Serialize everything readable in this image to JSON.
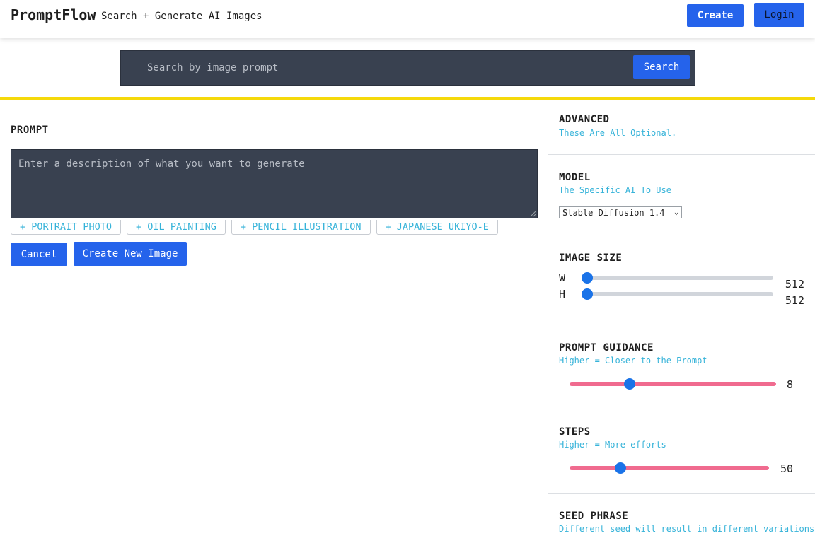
{
  "header": {
    "logo": "PromptFlow",
    "tagline": "Search + Generate AI Images",
    "create_label": "Create",
    "login_label": "Login"
  },
  "search": {
    "placeholder": "Search by image prompt",
    "button_label": "Search"
  },
  "prompt": {
    "title": "PROMPT",
    "placeholder": "Enter a description of what you want to generate",
    "chips": [
      "+ PORTRAIT PHOTO",
      "+ OIL PAINTING",
      "+ PENCIL ILLUSTRATION",
      "+ JAPANESE UKIYO-E"
    ],
    "cancel_label": "Cancel",
    "create_label": "Create New Image"
  },
  "advanced": {
    "title": "ADVANCED",
    "subtitle": "These Are All Optional.",
    "model": {
      "title": "MODEL",
      "subtitle": "The Specific AI To Use",
      "selected": "Stable Diffusion 1.4"
    },
    "image_size": {
      "title": "IMAGE SIZE",
      "width_label": "W",
      "width_value": "512",
      "width_fraction": 0.0,
      "height_label": "H",
      "height_value": "512",
      "height_fraction": 0.0
    },
    "guidance": {
      "title": "PROMPT GUIDANCE",
      "subtitle": "Higher = Closer to the Prompt",
      "value": "8",
      "fraction": 0.28
    },
    "steps": {
      "title": "STEPS",
      "subtitle": "Higher = More efforts",
      "value": "50",
      "fraction": 0.24
    },
    "seed": {
      "title": "SEED PHRASE",
      "subtitle": "Different seed will result in different variations"
    }
  },
  "colors": {
    "accent_blue": "#2563eb",
    "dark_field": "#394150",
    "highlight_yellow": "#f5d90a",
    "subtitle_cyan": "#36b3d9",
    "slider_pink": "#f06b8f",
    "slider_gray": "#d1d5db"
  }
}
